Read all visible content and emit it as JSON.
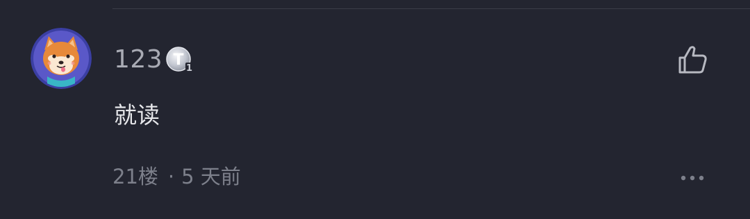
{
  "comment": {
    "username": "123",
    "level_badge": {
      "letter": "T",
      "number": "1",
      "icon": "level-badge-icon"
    },
    "text": "就读",
    "floor": "21楼",
    "separator": "·",
    "time": "5 天前"
  },
  "icons": {
    "like": "thumbs-up-icon",
    "more": "more-options-icon",
    "avatar": "shiba-dog-avatar"
  },
  "colors": {
    "background": "#232530",
    "username": "#a9abb4",
    "text": "#e6e7ea",
    "meta": "#7d808b",
    "divider": "#3a3d48"
  }
}
